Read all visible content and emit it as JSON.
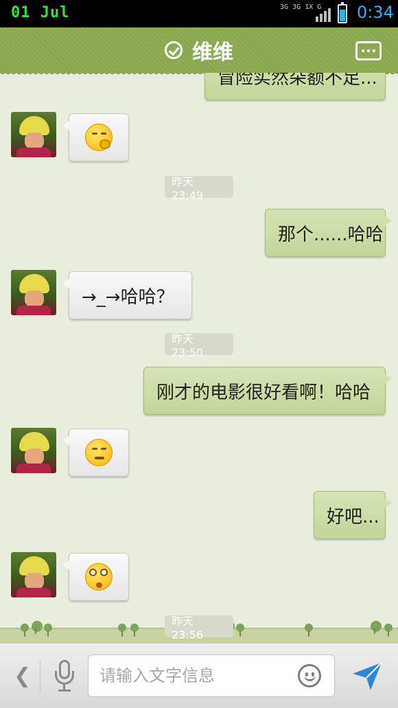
{
  "status_bar": {
    "date": "01 Jul",
    "network": "3G 3G 1X G",
    "time": "0:34"
  },
  "header": {
    "title": "维维",
    "icons": [
      "check-circle-icon",
      "more-icon"
    ]
  },
  "messages": [
    {
      "type": "text",
      "side": "right",
      "text": "冒险实然朵额不足...",
      "partial": true
    },
    {
      "type": "emoji",
      "side": "left",
      "emoji": "hand-over-mouth-emoji"
    },
    {
      "type": "time",
      "text": "昨天 23:49"
    },
    {
      "type": "text",
      "side": "right",
      "text": "那个......哈哈"
    },
    {
      "type": "text",
      "side": "left",
      "text": "→_→哈哈？"
    },
    {
      "type": "time",
      "text": "昨天 23:50"
    },
    {
      "type": "text",
      "side": "right",
      "text": "刚才的电影很好看啊！哈哈"
    },
    {
      "type": "emoji",
      "side": "left",
      "emoji": "unamused-emoji"
    },
    {
      "type": "text",
      "side": "right",
      "text": "好吧..."
    },
    {
      "type": "emoji",
      "side": "left",
      "emoji": "dizzy-emoji"
    },
    {
      "type": "time",
      "text": "昨天 23:56"
    }
  ],
  "input_bar": {
    "placeholder": "请输入文字信息",
    "icons": [
      "back-icon",
      "microphone-icon",
      "smiley-icon",
      "send-icon"
    ]
  },
  "colors": {
    "header": "#8aa84f",
    "chat_background": "#e9eddc",
    "sent_bubble": "#c8d9a0",
    "received_bubble": "#f2f2f2",
    "status_time": "#2fb3f0",
    "status_date": "#3be23b"
  }
}
